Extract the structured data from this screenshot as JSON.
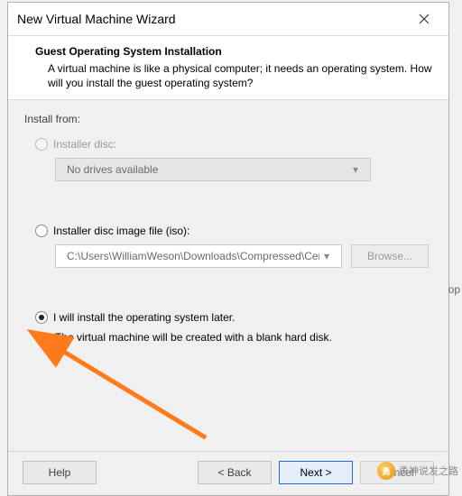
{
  "window": {
    "title": "New Virtual Machine Wizard"
  },
  "header": {
    "title": "Guest Operating System Installation",
    "description": "A virtual machine is like a physical computer; it needs an operating system. How will you install the guest operating system?"
  },
  "body": {
    "section_label": "Install from:",
    "opt_disc": {
      "label": "Installer disc:",
      "dropdown_value": "No drives available"
    },
    "opt_iso": {
      "label": "Installer disc image file (iso):",
      "path_value": "C:\\Users\\WilliamWeson\\Downloads\\Compressed\\Cen",
      "browse_label": "Browse..."
    },
    "opt_later": {
      "label": "I will install the operating system later.",
      "note": "The virtual machine will be created with a blank hard disk."
    }
  },
  "footer": {
    "help": "Help",
    "back": "< Back",
    "next": "Next >",
    "cancel": "Cancel"
  },
  "watermark": {
    "text": "勇神说发之路"
  },
  "misc": {
    "cropped_char": "op"
  }
}
